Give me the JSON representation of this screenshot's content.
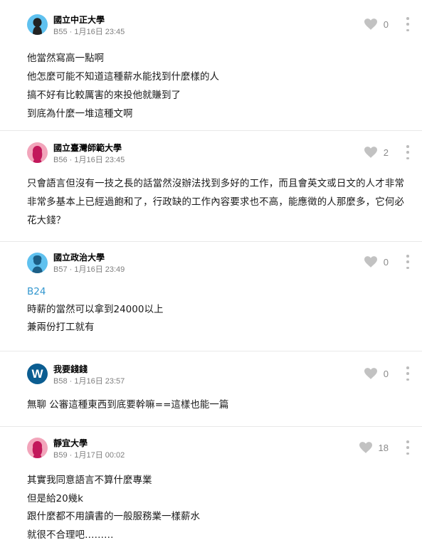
{
  "comments": [
    {
      "school": "國立中正大學",
      "floor": "B55",
      "time": "1月16日 23:45",
      "likes": "0",
      "avatar": "female-blue",
      "lines": [
        "他當然寫高一點啊",
        "他怎麼可能不知道這種薪水能找到什麼樣的人",
        "搞不好有比較厲害的來投他就賺到了",
        "到底為什麼一堆這種文啊"
      ]
    },
    {
      "school": "國立臺灣師範大學",
      "floor": "B56",
      "time": "1月16日 23:45",
      "likes": "2",
      "avatar": "female-pink",
      "text": "只會語言但沒有一技之長的話當然沒辦法找到多好的工作，而且會英文或日文的人才非常非常多基本上已經過飽和了，行政缺的工作內容要求也不高，能應徵的人那麼多，它何必花大錢？"
    },
    {
      "school": "國立政治大學",
      "floor": "B57",
      "time": "1月16日 23:49",
      "likes": "0",
      "avatar": "male-blue",
      "reference": "B24",
      "lines": [
        "時薪的當然可以拿到24000以上",
        "兼兩份打工就有"
      ]
    },
    {
      "school": "我要錢錢",
      "floor": "B58",
      "time": "1月16日 23:57",
      "likes": "0",
      "avatar": "letter-w",
      "avatar_letter": "W",
      "lines": [
        "無聊 公審這種東西到底要幹嘛==這樣也能一篇"
      ]
    },
    {
      "school": "靜宜大學",
      "floor": "B59",
      "time": "1月17日 00:02",
      "likes": "18",
      "avatar": "female-pink",
      "lines": [
        "其實我同意語言不算什麼專業",
        "但是給20幾k",
        "跟什麼都不用讀書的一般服務業一樣薪水",
        "就很不合理吧………"
      ]
    }
  ],
  "colors": {
    "avatar_blue": "#5fc1ef",
    "avatar_pink": "#f2a5bb",
    "avatar_navy": "#0b5d91",
    "reference_link": "#3397cf",
    "meta_gray": "#7e7e7e",
    "heart_gray": "#c2c2c2"
  },
  "icons": {
    "like": "heart-icon",
    "more": "more-vertical-icon"
  }
}
